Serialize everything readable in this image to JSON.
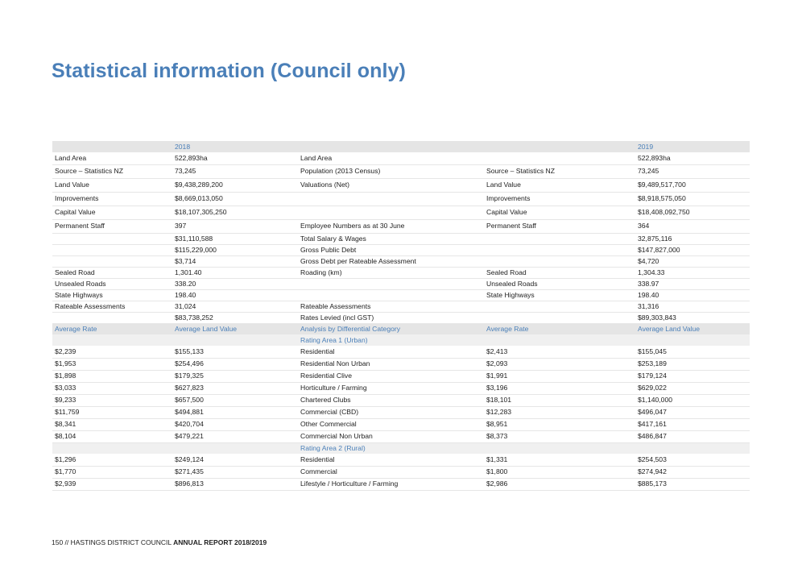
{
  "title": "Statistical information (Council only)",
  "footer": {
    "page": "150 // HASTINGS DISTRICT COUNCIL ",
    "report": "ANNUAL REPORT 2018/2019"
  },
  "top_header": {
    "y2018": "2018",
    "y2019": "2019"
  },
  "top_rows": [
    [
      "Land Area",
      "522,893ha",
      "Land Area",
      "",
      "522,893ha"
    ],
    [
      "Source – Statistics NZ",
      "73,245",
      "Population (2013 Census)",
      "Source – Statistics NZ",
      "73,245"
    ],
    [
      "Land Value",
      "$9,438,289,200",
      "Valuations (Net)",
      "Land Value",
      "$9,489,517,700"
    ],
    [
      "Improvements",
      "$8,669,013,050",
      "",
      "Improvements",
      "$8,918,575,050"
    ],
    [
      "Capital Value",
      "$18,107,305,250",
      "",
      "Capital Value",
      "$18,408,092,750"
    ],
    [
      "Permanent Staff",
      "397",
      "Employee Numbers as at 30 June",
      "Permanent Staff",
      "364"
    ],
    [
      "",
      "$31,110,588",
      "Total Salary & Wages",
      "",
      "32,875,116"
    ],
    [
      "",
      "$115,229,000",
      "Gross Public Debt",
      "",
      "$147,827,000"
    ],
    [
      "",
      "$3,714",
      "Gross Debt per Rateable Assessment",
      "",
      "$4,720"
    ],
    [
      "Sealed Road",
      "1,301.40",
      "Roading (km)",
      "Sealed Road",
      "1,304.33"
    ],
    [
      "Unsealed Roads",
      "338.20",
      "",
      "Unsealed Roads",
      "338.97"
    ],
    [
      "State Highways",
      "198.40",
      "",
      "State Highways",
      "198.40"
    ],
    [
      "Rateable Assessments",
      "31,024",
      "Rateable Assessments",
      "",
      "31,316"
    ],
    [
      "",
      "$83,738,252",
      "Rates Levied (incl GST)",
      "",
      "$89,303,843"
    ]
  ],
  "diff_header": [
    "Average Rate",
    "Average Land Value",
    "Analysis by Differential Category",
    "Average Rate",
    "Average Land Value"
  ],
  "area1_label": "Rating Area 1 (Urban)",
  "area1_rows": [
    [
      "$2,239",
      "$155,133",
      "Residential",
      "$2,413",
      "$155,045"
    ],
    [
      "$1,953",
      "$254,496",
      "Residential Non Urban",
      "$2,093",
      "$253,189"
    ],
    [
      "$1,898",
      "$179,325",
      "Residential Clive",
      "$1,991",
      "$179,124"
    ],
    [
      "$3,033",
      "$627,823",
      "Horticulture / Farming",
      "$3,196",
      "$629,022"
    ],
    [
      "$9,233",
      "$657,500",
      "Chartered Clubs",
      "$18,101",
      "$1,140,000"
    ],
    [
      "$11,759",
      "$494,881",
      "Commercial (CBD)",
      "$12,283",
      "$496,047"
    ],
    [
      "$8,341",
      "$420,704",
      "Other Commercial",
      "$8,951",
      "$417,161"
    ],
    [
      "$8,104",
      "$479,221",
      "Commercial Non Urban",
      "$8,373",
      "$486,847"
    ]
  ],
  "area2_label": "Rating Area 2 (Rural)",
  "area2_rows": [
    [
      "$1,296",
      "$249,124",
      "Residential",
      "$1,331",
      "$254,503"
    ],
    [
      "$1,770",
      "$271,435",
      "Commercial",
      "$1,800",
      "$274,942"
    ],
    [
      "$2,939",
      "$896,813",
      "Lifestyle / Horticulture / Farming",
      "$2,986",
      "$885,173"
    ]
  ]
}
